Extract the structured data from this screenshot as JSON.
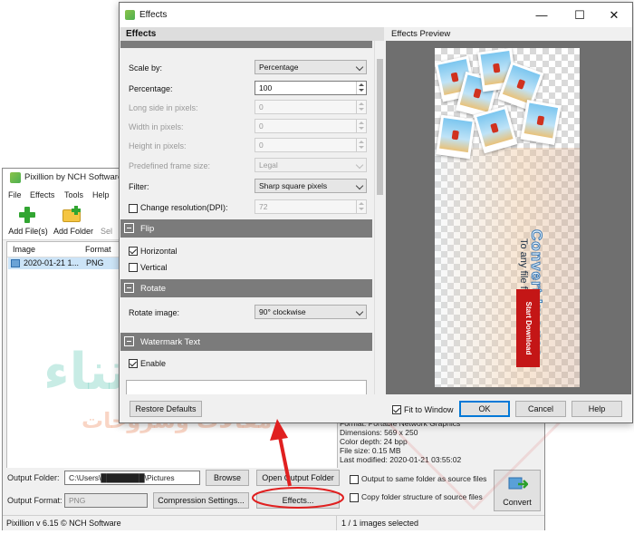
{
  "main_window": {
    "title": "Pixillion by NCH Software",
    "menu": [
      "File",
      "Effects",
      "Tools",
      "Help"
    ],
    "toolbar": {
      "add_files": "Add File(s)",
      "add_folder": "Add Folder",
      "truncated_next": "Sel"
    },
    "list": {
      "columns": [
        "Image",
        "Format"
      ],
      "rows": [
        {
          "image": "2020-01-21 1...",
          "format": "PNG"
        }
      ]
    },
    "file_info": [
      "Format: Portable Network Graphics",
      "Dimensions: 569 x 250",
      "Color depth: 24 bpp",
      "File size: 0.15 MB",
      "Last modified: 2020-01-21 03:55:02"
    ],
    "output_folder_label": "Output Folder:",
    "output_folder_value": "C:\\Users\\████████\\Pictures",
    "browse": "Browse",
    "open_output_folder": "Open Output Folder",
    "output_format_label": "Output Format:",
    "output_format_value": "PNG",
    "compression_settings": "Compression Settings...",
    "effects_button": "Effects...",
    "same_folder_label": "Output to same folder as source files",
    "copy_structure_label": "Copy folder structure of source files",
    "convert": "Convert",
    "status_left": "Pixillion v 6.15 © NCH Software",
    "status_right": "1 / 1 images selected"
  },
  "effects_window": {
    "title": "Effects",
    "left_header": "Effects",
    "right_header": "Effects Preview",
    "resize": {
      "scale_by_label": "Scale by:",
      "scale_by_value": "Percentage",
      "percentage_label": "Percentage:",
      "percentage_value": "100",
      "long_side_label": "Long side in pixels:",
      "long_side_value": "0",
      "width_label": "Width in pixels:",
      "width_value": "0",
      "height_label": "Height in pixels:",
      "height_value": "0",
      "frame_label": "Predefined frame size:",
      "frame_value": "Legal",
      "filter_label": "Filter:",
      "filter_value": "Sharp square pixels",
      "dpi_label": "Change resolution(DPI):",
      "dpi_value": "72",
      "dpi_checked": false
    },
    "flip": {
      "header": "Flip",
      "horizontal": "Horizontal",
      "horizontal_checked": true,
      "vertical": "Vertical",
      "vertical_checked": false
    },
    "rotate": {
      "header": "Rotate",
      "label": "Rotate image:",
      "value": "90° clockwise"
    },
    "watermark": {
      "header": "Watermark Text",
      "enable": "Enable",
      "enable_checked": true
    },
    "preview": {
      "title_text": "Convert Images",
      "subtitle_text": "To any file format you need",
      "button_text": "Start Download"
    },
    "restore_defaults": "Restore Defaults",
    "fit_to_window": "Fit to Window",
    "fit_checked": true,
    "ok": "OK",
    "cancel": "Cancel",
    "help": "Help"
  },
  "watermark_overlay": {
    "logo": "اقتناء",
    "tagline": "مقالات وشروحات"
  },
  "colors": {
    "section_header": "#7b7b7b",
    "list_selection": "#cce4f7",
    "ok_border": "#0078d7",
    "annotation": "#e02020"
  }
}
